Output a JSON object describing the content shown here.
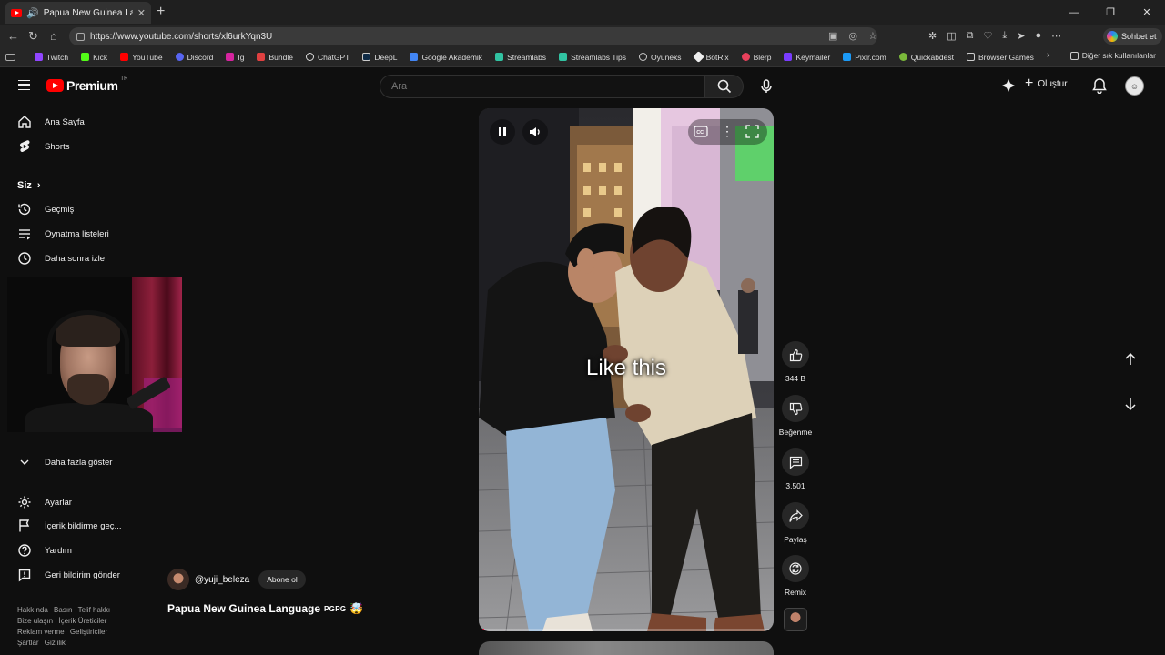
{
  "browser": {
    "tab_title": "Papua New Guinea Language",
    "url": "https://www.youtube.com/shorts/xl6urkYqn3U",
    "copilot_label": "Sohbet et",
    "bookmarks": [
      "Twitch",
      "Kick",
      "YouTube",
      "Discord",
      "Ig",
      "Bundle",
      "ChatGPT",
      "DeepL",
      "Google Akademik",
      "Streamlabs",
      "Streamlabs Tips",
      "Oyuneks",
      "BotRix",
      "Blerp",
      "Keymailer",
      "Pixlr.com",
      "Quickabdest",
      "Browser Games"
    ],
    "other_bookmarks": "Diğer sık kullanılanlar"
  },
  "masthead": {
    "logo_text": "Premium",
    "logo_country": "TR",
    "search_placeholder": "Ara",
    "create_label": "Oluştur"
  },
  "sidebar": {
    "home": "Ana Sayfa",
    "shorts": "Shorts",
    "you": "Siz",
    "history": "Geçmiş",
    "playlists": "Oynatma listeleri",
    "watch_later": "Daha sonra izle",
    "show_more": "Daha fazla göster",
    "settings": "Ayarlar",
    "report_history": "İçerik bildirme geç...",
    "help": "Yardım",
    "feedback": "Geri bildirim gönder",
    "footer": [
      "Hakkında",
      "Basın",
      "Telif hakkı",
      "Bize ulaşın",
      "İçerik Üreticiler",
      "Reklam verme",
      "Geliştiriciler",
      "Şartlar",
      "Gizlilik"
    ]
  },
  "player": {
    "caption": "Like this",
    "progress": 0.02
  },
  "actions": {
    "likes": "344 B",
    "dislike": "Beğenme",
    "comments": "3.501",
    "share": "Paylaş",
    "remix": "Remix"
  },
  "channel": {
    "handle": "@yuji_beleza",
    "subscribe": "Abone ol",
    "title": "Papua New Guinea Language",
    "title_tag": "PGPG",
    "title_emoji": "🤯"
  }
}
